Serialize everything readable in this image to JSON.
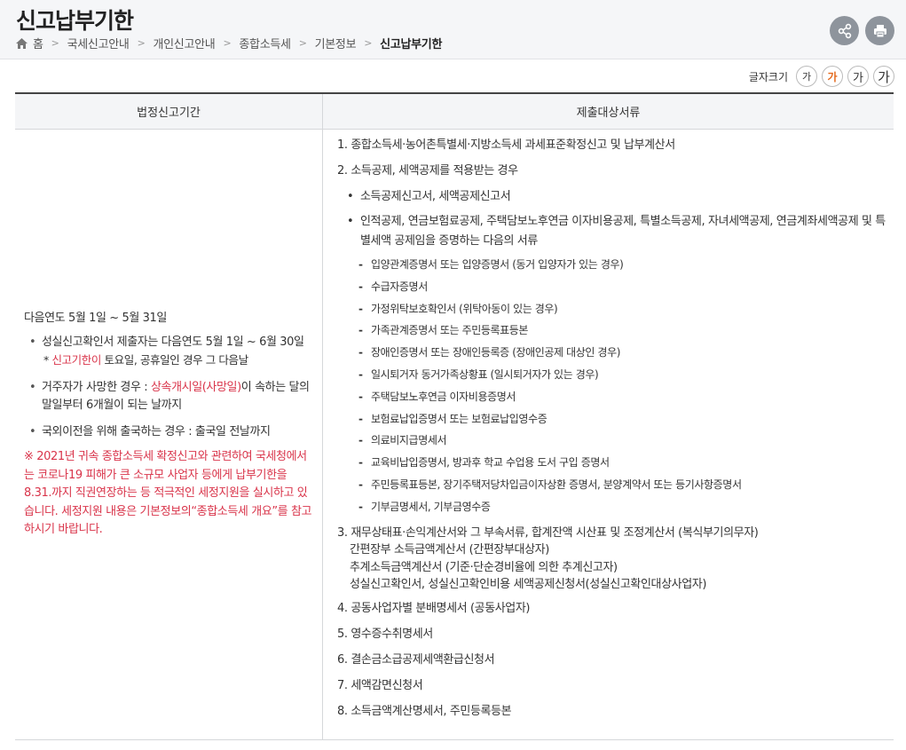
{
  "header": {
    "title": "신고납부기한",
    "breadcrumb": [
      "홈",
      "국세신고안내",
      "개인신고안내",
      "종합소득세",
      "기본정보",
      "신고납부기한"
    ],
    "icons": {
      "home": "home-icon",
      "share": "share-icon",
      "print": "print-icon"
    }
  },
  "font_size": {
    "label": "글자크기",
    "options": [
      "가",
      "가",
      "가",
      "가"
    ],
    "selected_index": 1,
    "accent_color": "#e46a1e"
  },
  "table": {
    "headers": [
      "법정신고기간",
      "제출대상서류"
    ],
    "left": {
      "period": "다음연도 5월 1일 ~ 5월 31일",
      "bullet1_main": "성실신고확인서 제출자는 다음연도 5월 1일 ~ 6월 30일",
      "bullet1_note_prefix": "* ",
      "bullet1_note_red": "신고기한이",
      "bullet1_note_rest": " 토요일, 공휴일인 경우 그 다음날",
      "bullet2_prefix": "거주자가 사망한 경우 : ",
      "bullet2_red": "상속개시일(사망일)",
      "bullet2_rest": "이 속하는 달의 말일부터 6개월이 되는 날까지",
      "bullet3": "국외이전을 위해 출국하는 경우 : 출국일 전날까지",
      "notice": "※ 2021년 귀속 종합소득세 확정신고와 관련하여 국세청에서는 코로나19 피해가 큰 소규모 사업자 등에게 납부기한을 8.31.까지 직권연장하는 등 적극적인 세정지원을 실시하고 있습니다. 세정지원 내용은 기본정보의“종합소득세 개요”를 참고하시기 바랍니다.",
      "red_color": "#d9344a"
    },
    "right": {
      "item1": "1. 종합소득세·농어촌특별세·지방소득세 과세표준확정신고 및 납부계산서",
      "item2": "2. 소득공제, 세액공제를 적용받는 경우",
      "bullet_a": "소득공제신고서, 세액공제신고서",
      "bullet_b": "인적공제, 연금보험료공제, 주택담보노후연금 이자비용공제, 특별소득공제, 자녀세액공제, 연금계좌세액공제 및 특별세액 공제임을 증명하는 다음의 서류",
      "docs": [
        "입양관계증명서 또는 입양증명서 (동거 입양자가 있는 경우)",
        "수급자증명서",
        "가정위탁보호확인서 (위탁아동이 있는 경우)",
        "가족관계증명서 또는 주민등록표등본",
        "장애인증명서 또는 장애인등록증 (장애인공제 대상인 경우)",
        "일시퇴거자 동거가족상황표 (일시퇴거자가 있는 경우)",
        "주택담보노후연금 이자비용증명서",
        "보험료납입증명서 또는 보험료납입영수증",
        "의료비지급명세서",
        "교육비납입증명서, 방과후 학교 수업용 도서 구입 증명서",
        "주민등록표등본, 장기주택저당차입금이자상환 증명서, 분양계약서 또는 등기사항증명서",
        "기부금명세서, 기부금영수증"
      ],
      "item3_lines": [
        "3. 재무상태표·손익계산서와 그 부속서류, 합계잔액 시산표 및 조정계산서 (복식부기의무자)",
        "간편장부 소득금액계산서 (간편장부대상자)",
        "추계소득금액계산서 (기준·단순경비율에 의한 추계신고자)",
        "성실신고확인서, 성실신고확인비용 세액공제신청서(성실신고확인대상사업자)"
      ],
      "item4": "4. 공동사업자별 분배명세서 (공동사업자)",
      "item5": "5. 영수증수취명세서",
      "item6": "6. 결손금소급공제세액환급신청서",
      "item7": "7. 세액감면신청서",
      "item8": "8. 소득금액계산명세서, 주민등록등본"
    }
  }
}
